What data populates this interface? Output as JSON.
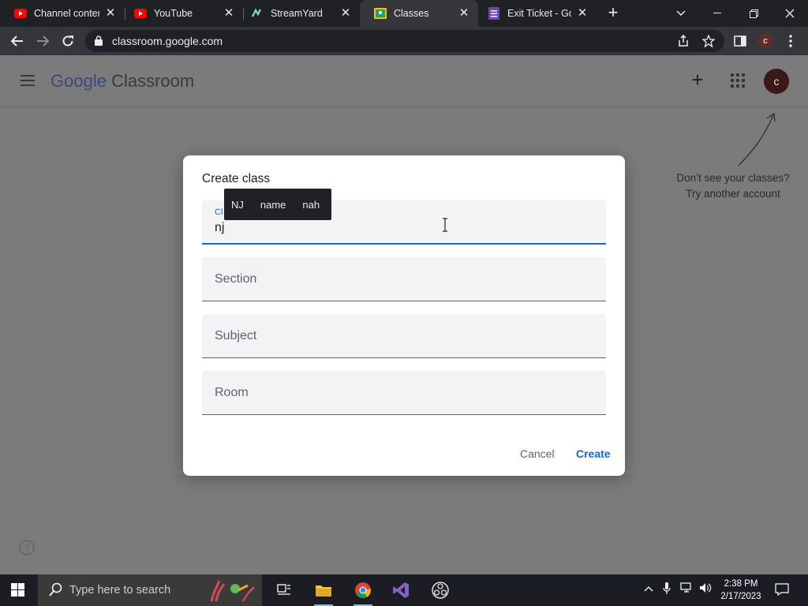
{
  "browser": {
    "tabs": [
      {
        "title": "Channel content",
        "icon": "youtube-icon"
      },
      {
        "title": "YouTube",
        "icon": "youtube-icon"
      },
      {
        "title": "StreamYard",
        "icon": "streamyard-icon"
      },
      {
        "title": "Classes",
        "icon": "classroom-icon",
        "active": true
      },
      {
        "title": "Exit Ticket - Goo",
        "icon": "forms-icon"
      }
    ],
    "url": "classroom.google.com",
    "profile_initial": "c"
  },
  "app": {
    "brand_google": "Google",
    "brand_product": "Classroom",
    "account_initial": "c",
    "hint_line1": "Don’t see your classes?",
    "hint_line2": "Try another account"
  },
  "dialog": {
    "title": "Create class",
    "class_name": {
      "label": "Cl",
      "value": "nj"
    },
    "section_placeholder": "Section",
    "subject_placeholder": "Subject",
    "room_placeholder": "Room",
    "cancel_label": "Cancel",
    "create_label": "Create"
  },
  "autocomplete": [
    "NJ",
    "name",
    "nah"
  ],
  "taskbar": {
    "search_placeholder": "Type here to search",
    "time": "2:38 PM",
    "date": "2/17/2023"
  },
  "colors": {
    "accent": "#1967d2",
    "overlay": "#7b7b7b",
    "dialog_bg": "#ffffff"
  }
}
